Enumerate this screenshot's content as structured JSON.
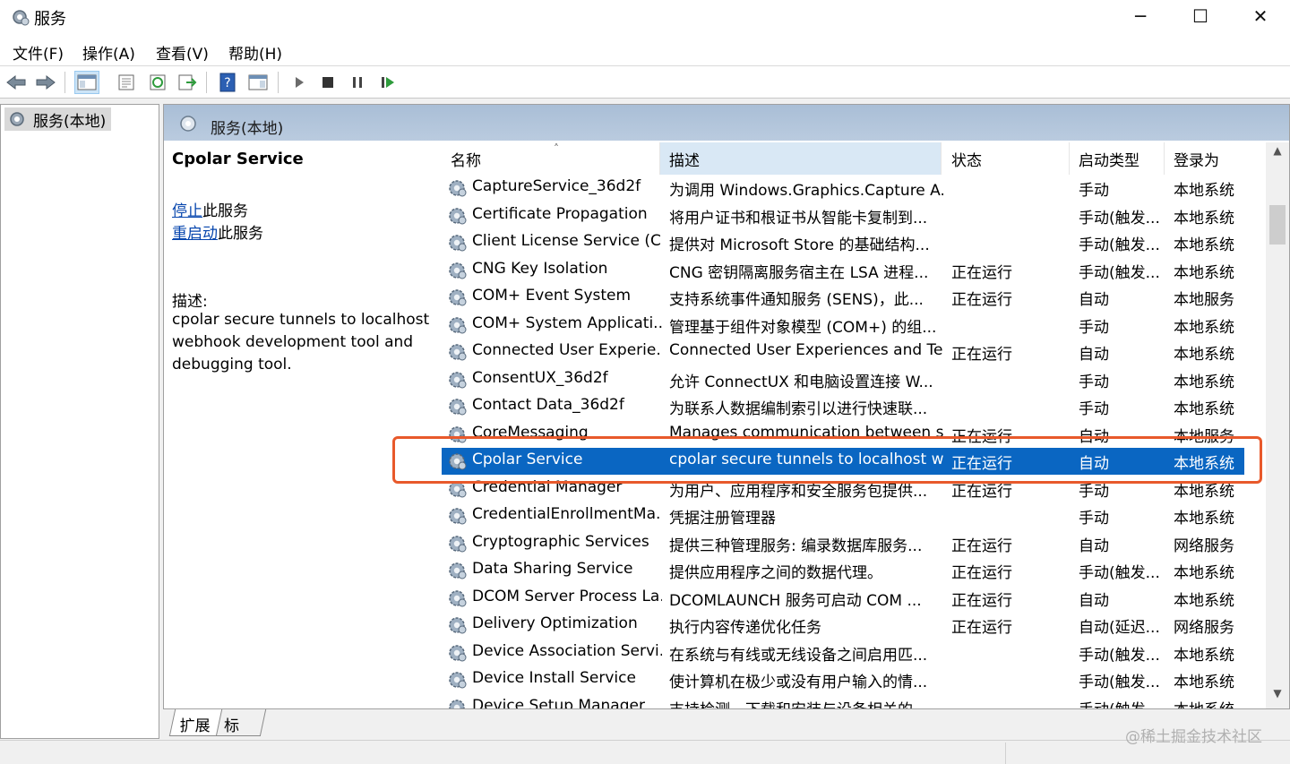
{
  "window": {
    "title": "服务",
    "controls": {
      "minimize": "─",
      "maximize": "☐",
      "close": "✕"
    }
  },
  "menu": [
    "文件(F)",
    "操作(A)",
    "查看(V)",
    "帮助(H)"
  ],
  "tree": {
    "root": "服务(本地)"
  },
  "pane_header": "服务(本地)",
  "detail": {
    "service_name": "Cpolar Service",
    "stop_link": "停止",
    "stop_suffix": "此服务",
    "restart_link": "重启动",
    "restart_suffix": "此服务",
    "desc_label": "描述:",
    "desc_text": "cpolar secure tunnels to localhost webhook development tool and debugging tool."
  },
  "columns": [
    "名称",
    "描述",
    "状态",
    "启动类型",
    "登录为"
  ],
  "sort_indicator": "˄",
  "rows": [
    {
      "name": "CaptureService_36d2f",
      "desc": "为调用 Windows.Graphics.Capture A...",
      "status": "",
      "start": "手动",
      "logon": "本地系统"
    },
    {
      "name": "Certificate Propagation",
      "desc": "将用户证书和根证书从智能卡复制到...",
      "status": "",
      "start": "手动(触发...",
      "logon": "本地系统"
    },
    {
      "name": "Client License Service (C...",
      "desc": "提供对 Microsoft Store 的基础结构...",
      "status": "",
      "start": "手动(触发...",
      "logon": "本地系统"
    },
    {
      "name": "CNG Key Isolation",
      "desc": "CNG 密钥隔离服务宿主在 LSA 进程...",
      "status": "正在运行",
      "start": "手动(触发...",
      "logon": "本地系统"
    },
    {
      "name": "COM+ Event System",
      "desc": "支持系统事件通知服务 (SENS)，此...",
      "status": "正在运行",
      "start": "自动",
      "logon": "本地服务"
    },
    {
      "name": "COM+ System Applicati...",
      "desc": "管理基于组件对象模型 (COM+) 的组...",
      "status": "",
      "start": "手动",
      "logon": "本地系统"
    },
    {
      "name": "Connected User Experie...",
      "desc": "Connected User Experiences and Te...",
      "status": "正在运行",
      "start": "自动",
      "logon": "本地系统"
    },
    {
      "name": "ConsentUX_36d2f",
      "desc": "允许 ConnectUX 和电脑设置连接 W...",
      "status": "",
      "start": "手动",
      "logon": "本地系统"
    },
    {
      "name": "Contact Data_36d2f",
      "desc": "为联系人数据编制索引以进行快速联...",
      "status": "",
      "start": "手动",
      "logon": "本地系统"
    },
    {
      "name": "CoreMessaging",
      "desc": "Manages communication between s...",
      "status": "正在运行",
      "start": "自动",
      "logon": "本地服务"
    },
    {
      "name": "Cpolar Service",
      "desc": "cpolar secure tunnels to localhost w...",
      "status": "正在运行",
      "start": "自动",
      "logon": "本地系统"
    },
    {
      "name": "Credential Manager",
      "desc": "为用户、应用程序和安全服务包提供...",
      "status": "正在运行",
      "start": "手动",
      "logon": "本地系统"
    },
    {
      "name": "CredentialEnrollmentMa...",
      "desc": "凭据注册管理器",
      "status": "",
      "start": "手动",
      "logon": "本地系统"
    },
    {
      "name": "Cryptographic Services",
      "desc": "提供三种管理服务: 编录数据库服务...",
      "status": "正在运行",
      "start": "自动",
      "logon": "网络服务"
    },
    {
      "name": "Data Sharing Service",
      "desc": "提供应用程序之间的数据代理。",
      "status": "正在运行",
      "start": "手动(触发...",
      "logon": "本地系统"
    },
    {
      "name": "DCOM Server Process La...",
      "desc": "DCOMLAUNCH 服务可启动 COM ...",
      "status": "正在运行",
      "start": "自动",
      "logon": "本地系统"
    },
    {
      "name": "Delivery Optimization",
      "desc": "执行内容传递优化任务",
      "status": "正在运行",
      "start": "自动(延迟...",
      "logon": "网络服务"
    },
    {
      "name": "Device Association Servi...",
      "desc": "在系统与有线或无线设备之间启用匹...",
      "status": "",
      "start": "手动(触发...",
      "logon": "本地系统"
    },
    {
      "name": "Device Install Service",
      "desc": "使计算机在极少或没有用户输入的情...",
      "status": "",
      "start": "手动(触发...",
      "logon": "本地系统"
    },
    {
      "name": "Device Setup Manager",
      "desc": "支持检测、下载和安装与设备相关的...",
      "status": "",
      "start": "手动(触发...",
      "logon": "本地系统"
    }
  ],
  "tabs": [
    "扩展",
    "标准"
  ],
  "watermark": "@稀土掘金技术社区",
  "colors": {
    "selection": "#0a66c2",
    "highlight_box": "#e8592b",
    "link": "#0645ad",
    "header": "#a9bed6"
  }
}
